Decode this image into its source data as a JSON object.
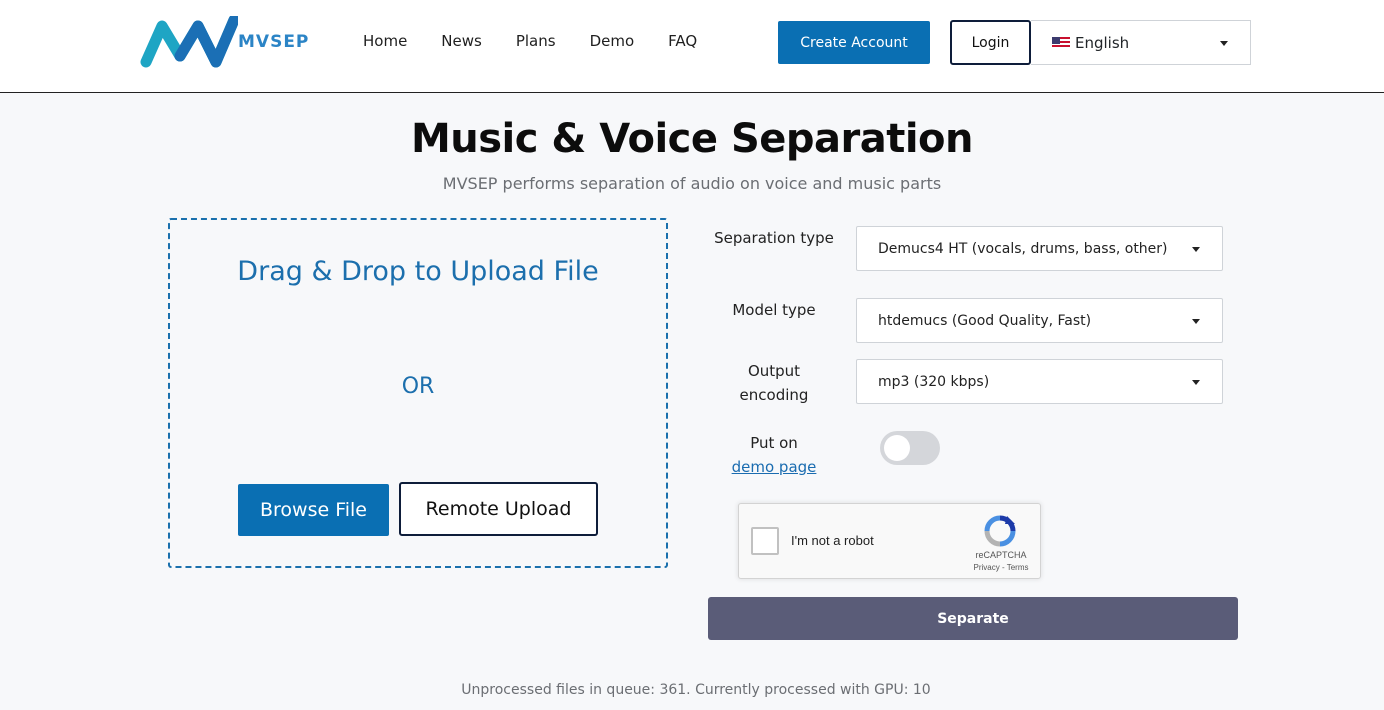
{
  "brand": {
    "logo_text": "MVSEP",
    "color": "#2b84c6"
  },
  "nav": {
    "items": [
      {
        "label": "Home"
      },
      {
        "label": "News"
      },
      {
        "label": "Plans"
      },
      {
        "label": "Demo"
      },
      {
        "label": "FAQ"
      }
    ],
    "create_account": "Create Account",
    "login": "Login",
    "language": {
      "icon": "us-flag-icon",
      "selected": "English"
    }
  },
  "hero": {
    "title": "Music & Voice Separation",
    "subtitle": "MVSEP performs separation of audio on voice and music parts"
  },
  "upload": {
    "drag_drop": "Drag & Drop to Upload File",
    "or": "OR",
    "browse": "Browse File",
    "remote": "Remote Upload"
  },
  "form": {
    "separation_type": {
      "label": "Separation type",
      "value": "Demucs4 HT (vocals, drums, bass, other)"
    },
    "model_type": {
      "label": "Model type",
      "value": "htdemucs (Good Quality, Fast)"
    },
    "output_encoding": {
      "label": "Output encoding",
      "value": "mp3 (320 kbps)"
    },
    "demo_page": {
      "label_prefix": "Put on",
      "link": "demo page",
      "enabled": false
    },
    "captcha": {
      "text": "I'm not a robot",
      "brand": "reCAPTCHA",
      "terms": "Privacy - Terms"
    },
    "submit": "Separate"
  },
  "status": {
    "queue": "Unprocessed files in queue: 361. Currently processed with GPU: 10"
  },
  "colors": {
    "primary": "#0a6fb3",
    "separate": "#5a5c78"
  }
}
